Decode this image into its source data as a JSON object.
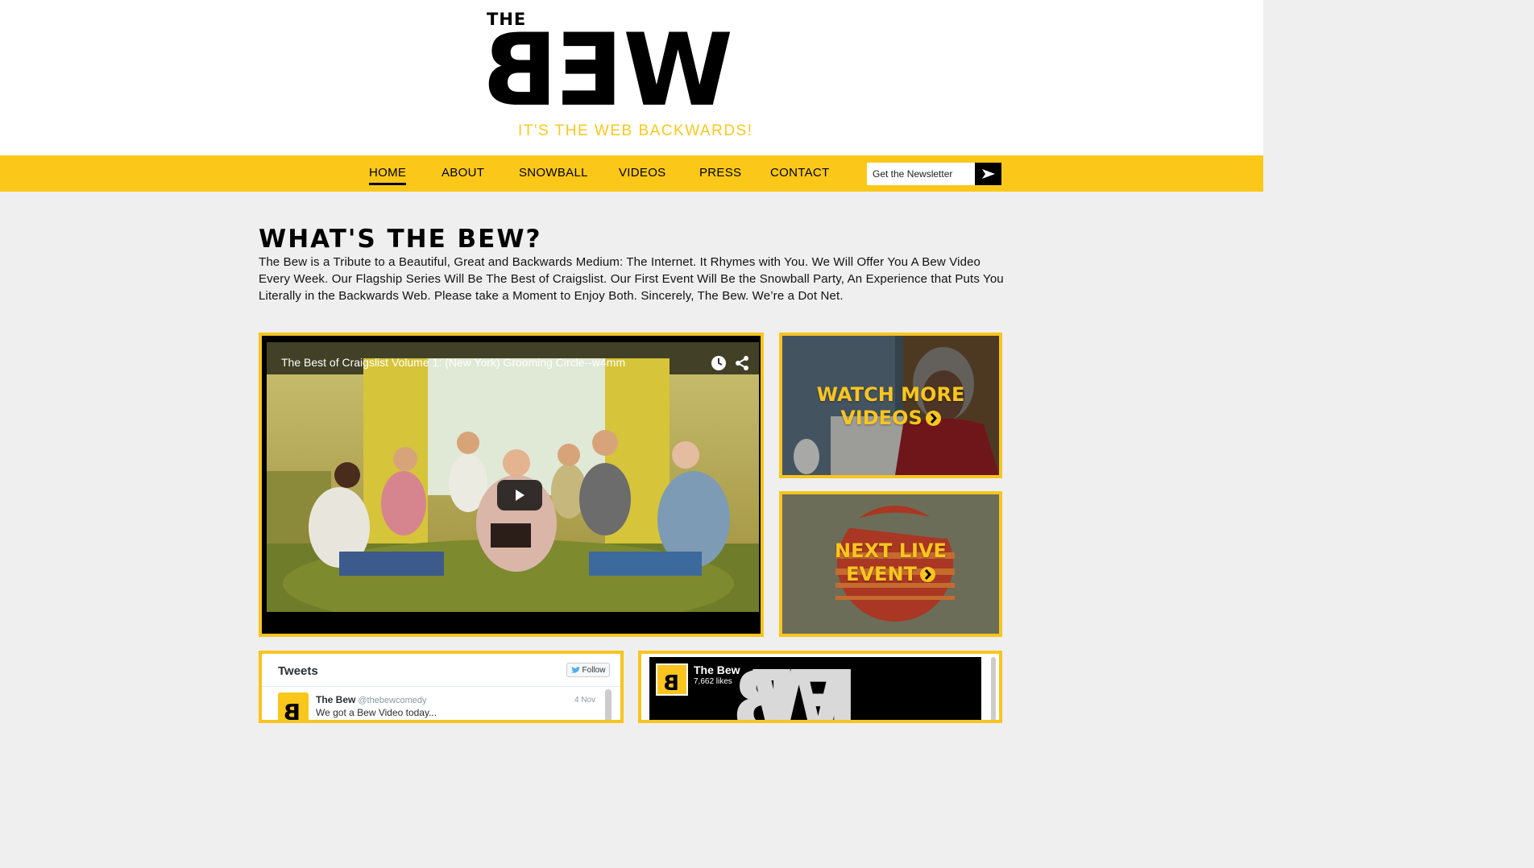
{
  "header": {
    "logo_the": "THE",
    "logo_letters": [
      "B",
      "E",
      "W"
    ],
    "tagline": "IT'S THE WEB BACKWARDS!"
  },
  "nav": {
    "items": [
      "HOME",
      "ABOUT",
      "SNOWBALL",
      "VIDEOS",
      "PRESS",
      "CONTACT"
    ],
    "active": "HOME",
    "newsletter_placeholder": "Get the Newsletter",
    "submit_icon": "arrow-right-icon"
  },
  "intro": {
    "title": "WHAT'S THE BEW?",
    "text": "The Bew is a Tribute to a Beautiful, Great and Backwards Medium: The Internet.  It Rhymes with You.  We Will Offer You A Bew Video Every Week.  Our Flagship Series Will Be The Best of Craigslist.  Our First Event Will Be the Snowball Party, An Experience that Puts You Literally in the Backwards Web.  Please take a Moment to Enjoy Both.  Sincerely, The Bew.  We’re a Dot Net."
  },
  "video": {
    "title": "The Best of Craigslist Volume 1: (New York) Grooming Circle--w4mm",
    "icons": [
      "clock-icon",
      "share-icon",
      "play-icon"
    ]
  },
  "tiles": {
    "videos": {
      "line1": "WATCH MORE",
      "line2": "VIDEOS"
    },
    "event": {
      "line1": "NEXT LIVE",
      "line2": "EVENT"
    }
  },
  "tweets": {
    "header": "Tweets",
    "follow_label": "Follow",
    "tweet": {
      "name": "The Bew",
      "handle": "@thebewcomedy",
      "date": "4 Nov",
      "text": "We got a Bew Video today..."
    }
  },
  "facebook": {
    "name": "The Bew",
    "likes": "7,662 likes"
  },
  "colors": {
    "accent": "#fbc81a",
    "background": "#efefef",
    "text": "#000000"
  }
}
